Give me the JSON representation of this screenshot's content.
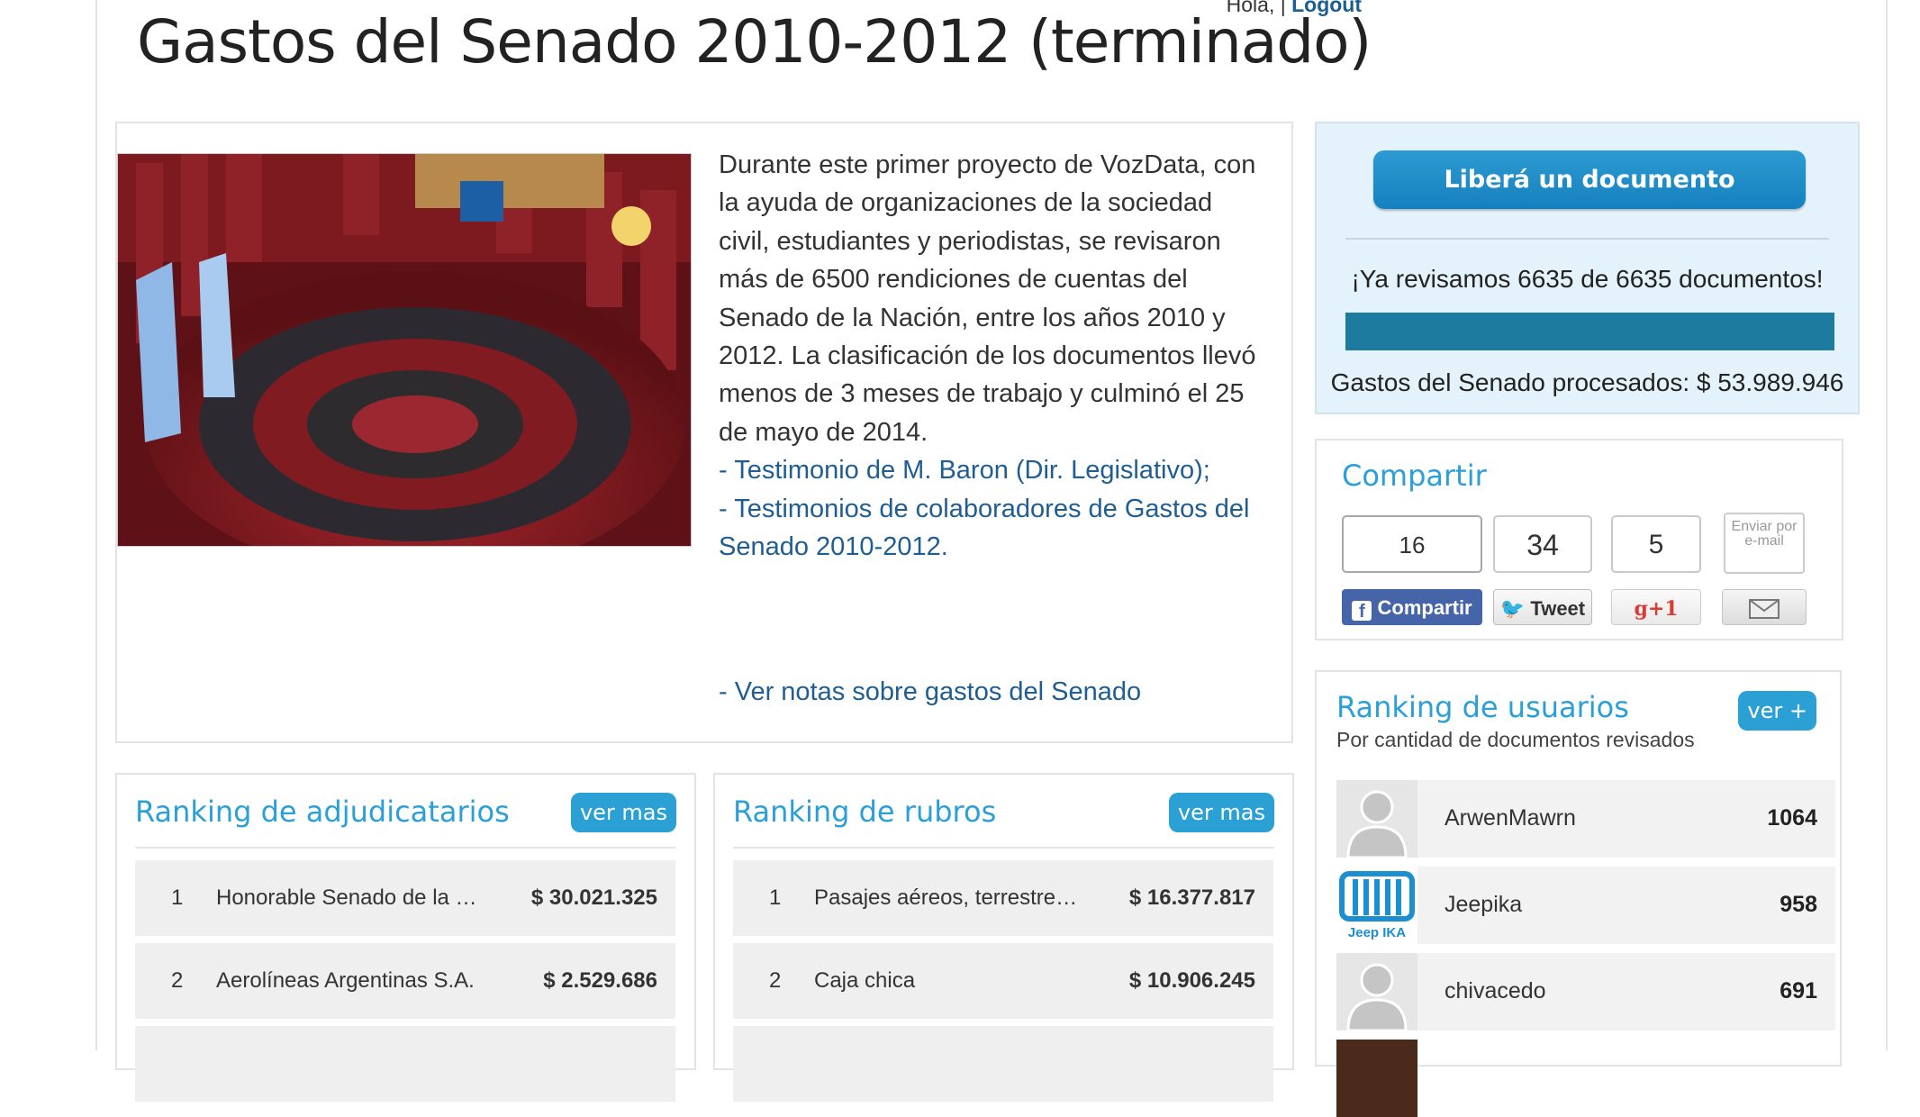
{
  "header": {
    "hello": "Hola, |",
    "logout": "Logout",
    "title": "Gastos del Senado 2010-2012 (terminado)"
  },
  "intro": {
    "paragraph": "Durante este primer proyecto de VozData, con la ayuda de organizaciones de la sociedad civil, estudiantes y periodistas, se revisaron más de 6500 rendiciones de cuentas del Senado de la Nación, entre los años 2010 y 2012. La clasificación de los documentos llevó menos de 3 meses de trabajo y culminó el 25 de mayo de 2014.",
    "link1": "- Testimonio de M. Baron (Dir. Legislativo);",
    "link2": "- Testimonios de colaboradores de Gastos del Senado 2010-2012.",
    "link3": "- Ver notas sobre gastos del Senado"
  },
  "cta": {
    "button": "Liberá un documento",
    "reviewed": "¡Ya revisamos 6635 de 6635 documentos!",
    "progress": 1.0,
    "spent": "Gastos del Senado procesados: $ 53.989.946"
  },
  "share": {
    "title": "Compartir",
    "fb_count": "16",
    "fb_label": "Compartir",
    "tw_count": "34",
    "tw_label": "Tweet",
    "gp_count": "5",
    "gp_label": "g+1",
    "email_label": "Enviar por e-mail"
  },
  "users": {
    "title": "Ranking de usuarios",
    "more": "ver +",
    "subtitle": "Por cantidad de documentos revisados",
    "rows": [
      {
        "name": "ArwenMawrn",
        "score": "1064"
      },
      {
        "name": "Jeepika",
        "score": "958",
        "logo_text": "Jeep IKA"
      },
      {
        "name": "chivacedo",
        "score": "691"
      }
    ]
  },
  "adjudicatarios": {
    "title": "Ranking de adjudicatarios",
    "more": "ver mas",
    "rows": [
      {
        "n": "1",
        "name": "Honorable Senado de la Nación",
        "value": "$ 30.021.325"
      },
      {
        "n": "2",
        "name": "Aerolíneas Argentinas S.A.",
        "value": "$ 2.529.686"
      }
    ]
  },
  "rubros": {
    "title": "Ranking de rubros",
    "more": "ver mas",
    "rows": [
      {
        "n": "1",
        "name": "Pasajes aéreos, terrestres y fluviales",
        "value": "$ 16.377.817"
      },
      {
        "n": "2",
        "name": "Caja chica",
        "value": "$ 10.906.245"
      }
    ]
  },
  "colors": {
    "accent": "#2aa0d4",
    "link": "#1f5d92",
    "progress": "#1e7ba0",
    "facebook": "#4565a8"
  }
}
